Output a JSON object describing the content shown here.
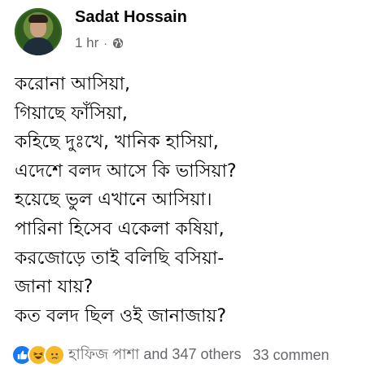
{
  "post": {
    "author": "Sadat Hossain",
    "time": "1 hr",
    "separator": "·",
    "privacy_icon": "globe-icon"
  },
  "poem": {
    "lines": [
      "করোনা আসিয়া,",
      "গিয়াছে ফাঁসিয়া,",
      "কহিছে দুঃখে, খানিক হাসিয়া,",
      "এদেশে বলদ আসে কি ভাসিয়া?",
      "হয়েছে ভুল এখানে আসিয়া।",
      "পারিনা হিসেব একেলা কষিয়া,",
      "করজোড়ে তাই বলিছি বসিয়া-",
      "জানা যায়?",
      "কত বলদ ছিল ওই জানাজায়?"
    ]
  },
  "footer": {
    "reactions": [
      "like-icon",
      "haha-icon",
      "sad-icon"
    ],
    "reactors_text": "হাফিজ পাশা and 347 others",
    "comments_text": "33 commen"
  },
  "colors": {
    "text_primary": "#050505",
    "text_secondary": "#65676b",
    "like_blue": "#1877f2",
    "emoji_yellow": "#f7b928"
  }
}
